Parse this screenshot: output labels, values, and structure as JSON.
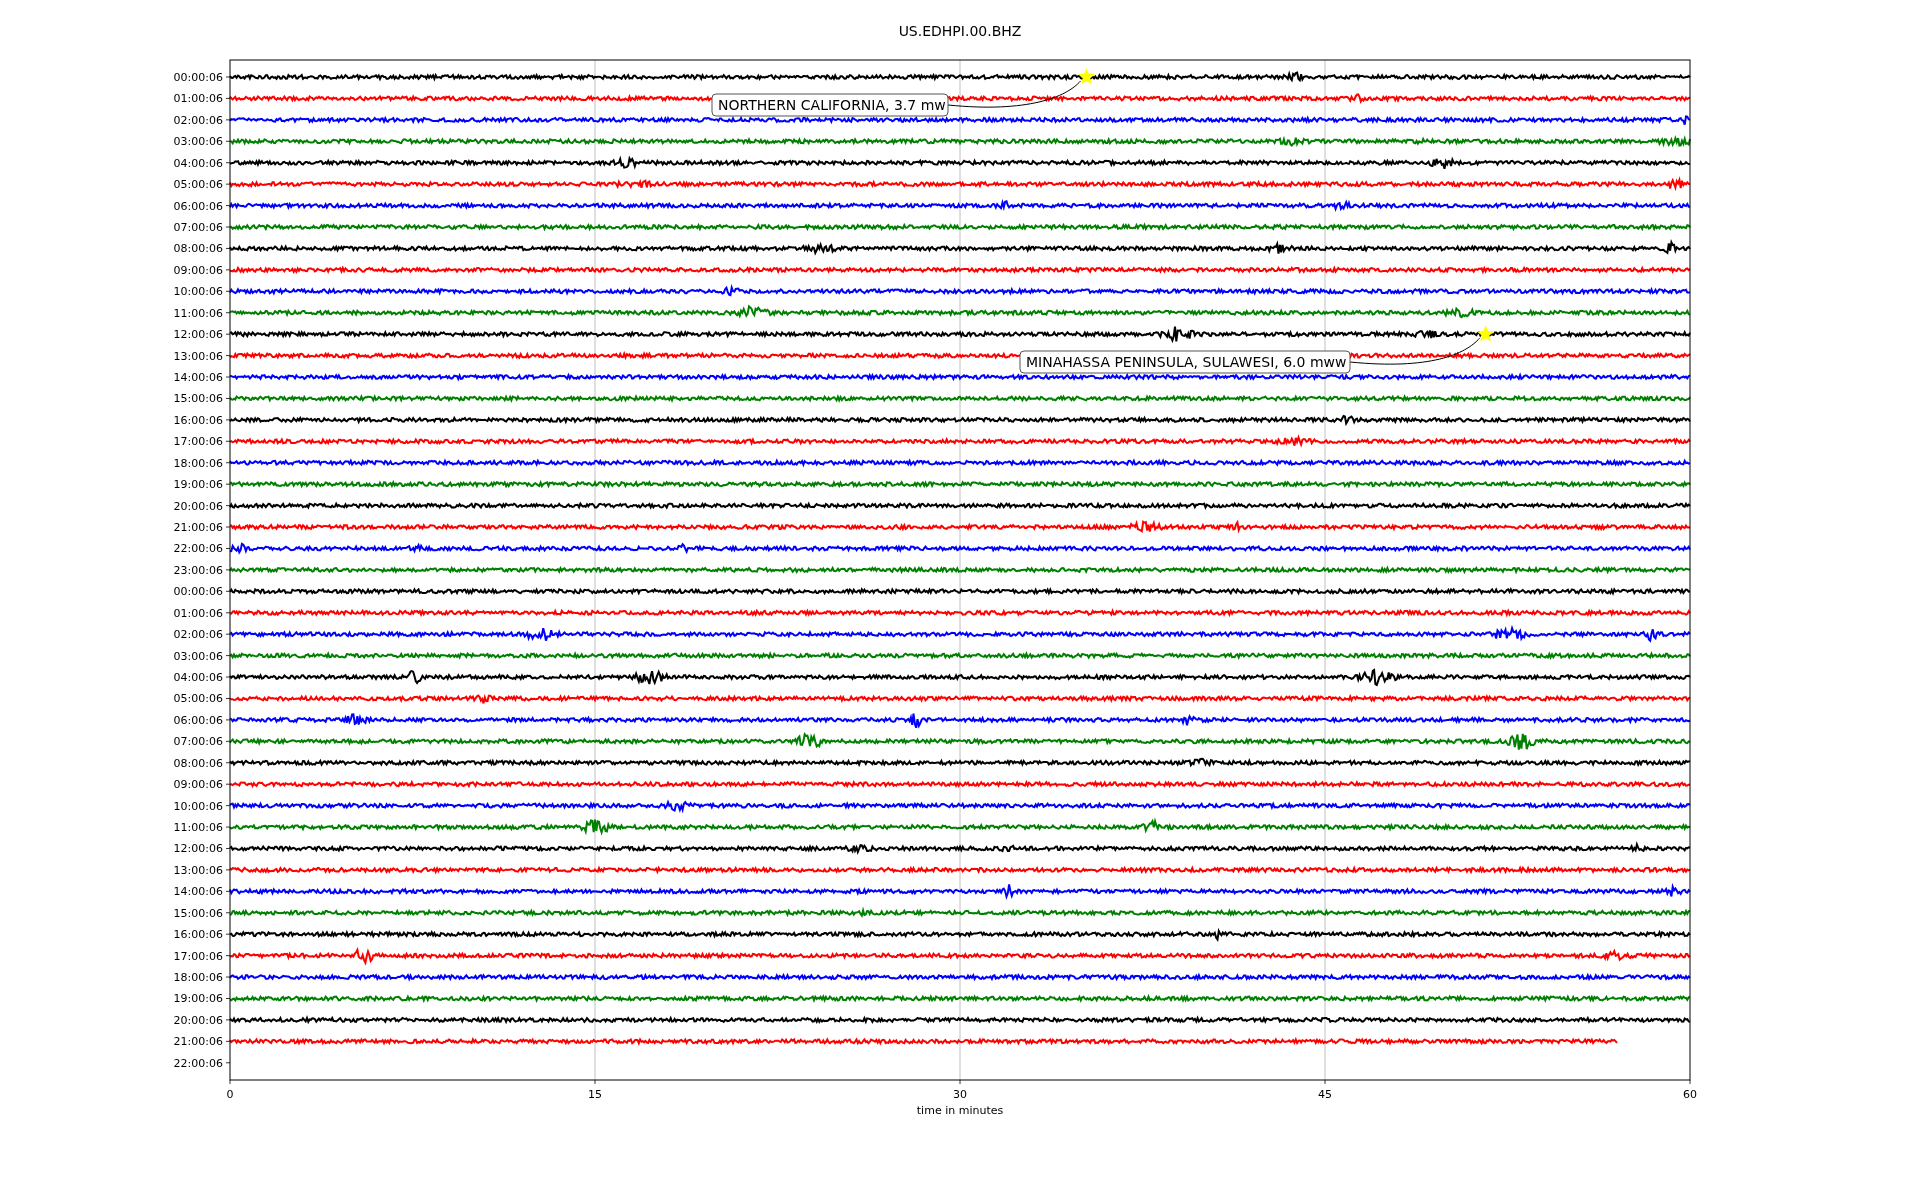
{
  "title": "US.EDHPI.00.BHZ",
  "xlabel": "time in minutes",
  "xticks": [
    "0",
    "15",
    "30",
    "45",
    "60"
  ],
  "rows": [
    {
      "label": "00:00:06",
      "color": "#000000",
      "level": 1
    },
    {
      "label": "01:00:06",
      "color": "#ff0000",
      "level": 1
    },
    {
      "label": "02:00:06",
      "color": "#0000ff",
      "level": 1
    },
    {
      "label": "03:00:06",
      "color": "#008000",
      "level": 1
    },
    {
      "label": "04:00:06",
      "color": "#000000",
      "level": 1
    },
    {
      "label": "05:00:06",
      "color": "#ff0000",
      "level": 1
    },
    {
      "label": "06:00:06",
      "color": "#0000ff",
      "level": 1
    },
    {
      "label": "07:00:06",
      "color": "#008000",
      "level": 1
    },
    {
      "label": "08:00:06",
      "color": "#000000",
      "level": 1
    },
    {
      "label": "09:00:06",
      "color": "#ff0000",
      "level": 1
    },
    {
      "label": "10:00:06",
      "color": "#0000ff",
      "level": 1
    },
    {
      "label": "11:00:06",
      "color": "#008000",
      "level": 1
    },
    {
      "label": "12:00:06",
      "color": "#000000",
      "level": 1
    },
    {
      "label": "13:00:06",
      "color": "#ff0000",
      "level": 1
    },
    {
      "label": "14:00:06",
      "color": "#0000ff",
      "level": 1
    },
    {
      "label": "15:00:06",
      "color": "#008000",
      "level": 1
    },
    {
      "label": "16:00:06",
      "color": "#000000",
      "level": 1
    },
    {
      "label": "17:00:06",
      "color": "#ff0000",
      "level": 1
    },
    {
      "label": "18:00:06",
      "color": "#0000ff",
      "level": 1
    },
    {
      "label": "19:00:06",
      "color": "#008000",
      "level": 1
    },
    {
      "label": "20:00:06",
      "color": "#000000",
      "level": 1
    },
    {
      "label": "21:00:06",
      "color": "#ff0000",
      "level": 1
    },
    {
      "label": "22:00:06",
      "color": "#0000ff",
      "level": 1
    },
    {
      "label": "23:00:06",
      "color": "#008000",
      "level": 1
    },
    {
      "label": "00:00:06",
      "color": "#000000",
      "level": 1
    },
    {
      "label": "01:00:06",
      "color": "#ff0000",
      "level": 1
    },
    {
      "label": "02:00:06",
      "color": "#0000ff",
      "level": 1
    },
    {
      "label": "03:00:06",
      "color": "#008000",
      "level": 1
    },
    {
      "label": "04:00:06",
      "color": "#000000",
      "level": 1
    },
    {
      "label": "05:00:06",
      "color": "#ff0000",
      "level": 1
    },
    {
      "label": "06:00:06",
      "color": "#0000ff",
      "level": 1
    },
    {
      "label": "07:00:06",
      "color": "#008000",
      "level": 1
    },
    {
      "label": "08:00:06",
      "color": "#000000",
      "level": 1
    },
    {
      "label": "09:00:06",
      "color": "#ff0000",
      "level": 1
    },
    {
      "label": "10:00:06",
      "color": "#0000ff",
      "level": 1
    },
    {
      "label": "11:00:06",
      "color": "#008000",
      "level": 1
    },
    {
      "label": "12:00:06",
      "color": "#000000",
      "level": 1
    },
    {
      "label": "13:00:06",
      "color": "#ff0000",
      "level": 1
    },
    {
      "label": "14:00:06",
      "color": "#0000ff",
      "level": 1
    },
    {
      "label": "15:00:06",
      "color": "#008000",
      "level": 1
    },
    {
      "label": "16:00:06",
      "color": "#000000",
      "level": 1
    },
    {
      "label": "17:00:06",
      "color": "#ff0000",
      "level": 1
    },
    {
      "label": "18:00:06",
      "color": "#0000ff",
      "level": 1
    },
    {
      "label": "19:00:06",
      "color": "#008000",
      "level": 1
    },
    {
      "label": "20:00:06",
      "color": "#000000",
      "level": 1
    },
    {
      "label": "21:00:06",
      "color": "#ff0000",
      "level": 0.95
    },
    {
      "label": "22:00:06"
    }
  ],
  "events": [
    {
      "label": "NORTHERN CALIFORNIA, 3.7 mw"
    },
    {
      "label": "MINAHASSA PENINSULA, SULAWESI, 6.0 mww"
    }
  ]
}
